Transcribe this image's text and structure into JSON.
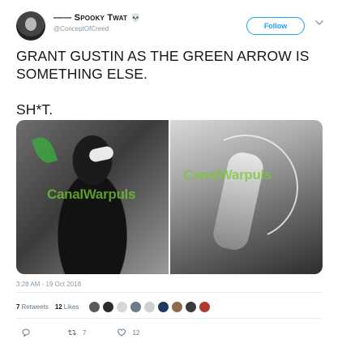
{
  "tweet": {
    "author": {
      "display_name": "—— Spooky Twat",
      "emoji": "💀",
      "handle": "@ConceptOfCreed"
    },
    "follow_label": "Follow",
    "text": "GRANT GUSTIN AS THE GREEN ARROW IS SOMETHING ELSE.\n\nSH*T.",
    "media": {
      "watermark_text": "CanalWarpuls",
      "images": [
        {
          "icon": "green-arrow-costume-photo"
        },
        {
          "icon": "archer-with-bow-photo"
        }
      ]
    },
    "timestamp": "3:28 AM - 19 Oct 2018",
    "stats": {
      "retweets_count": "7",
      "retweets_label": "Retweets",
      "likes_count": "12",
      "likes_label": "Likes",
      "liker_avatar_colors": [
        "#5a5a5a",
        "#2b2b2b",
        "#d7d7d7",
        "#6c7a89",
        "#cfcfcf",
        "#1f3a5f",
        "#8e6b4a",
        "#3a3a3a",
        "#b03a2e"
      ]
    },
    "actions": {
      "reply_count": "",
      "retweet_count": "7",
      "like_count": "12"
    }
  }
}
